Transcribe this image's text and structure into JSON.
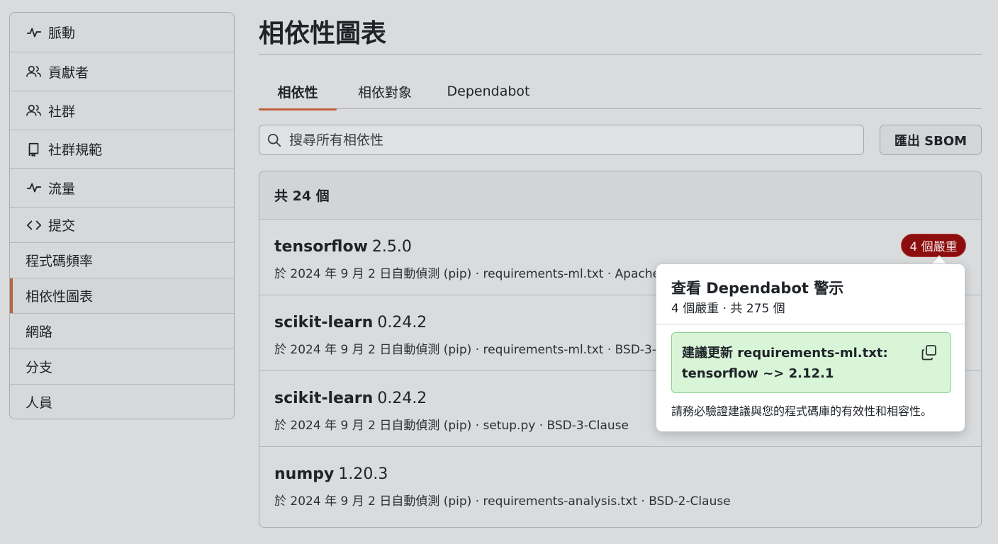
{
  "sidebar": {
    "items": [
      {
        "label": "脈動",
        "icon": "pulse-icon"
      },
      {
        "label": "貢獻者",
        "icon": "people-icon"
      },
      {
        "label": "社群",
        "icon": "people-icon"
      },
      {
        "label": "社群規範",
        "icon": "book-icon"
      },
      {
        "label": "流量",
        "icon": "pulse-icon"
      },
      {
        "label": "提交",
        "icon": "code-icon"
      },
      {
        "label": "程式碼頻率",
        "icon": ""
      },
      {
        "label": "相依性圖表",
        "icon": ""
      },
      {
        "label": "網路",
        "icon": ""
      },
      {
        "label": "分支",
        "icon": ""
      },
      {
        "label": "人員",
        "icon": ""
      }
    ],
    "active_index": 7
  },
  "page": {
    "title": "相依性圖表"
  },
  "tabs": [
    {
      "label": "相依性"
    },
    {
      "label": "相依對象"
    },
    {
      "label": "Dependabot"
    }
  ],
  "search": {
    "placeholder": "搜尋所有相依性"
  },
  "export_label": "匯出 SBOM",
  "dependencies": {
    "count_label": "共 24 個",
    "rows": [
      {
        "name": "tensorflow",
        "version": "2.5.0",
        "meta": "於 2024 年 9 月 2 日自動偵測 (pip) · requirements-ml.txt · Apache-2.0"
      },
      {
        "name": "scikit-learn",
        "version": "0.24.2",
        "meta": "於 2024 年 9 月 2 日自動偵測 (pip) · requirements-ml.txt · BSD-3-Clause"
      },
      {
        "name": "scikit-learn",
        "version": "0.24.2",
        "meta": "於 2024 年 9 月 2 日自動偵測 (pip) · setup.py · BSD-3-Clause"
      },
      {
        "name": "numpy",
        "version": "1.20.3",
        "meta": "於 2024 年 9 月 2 日自動偵測 (pip) · requirements-analysis.txt · BSD-2-Clause"
      }
    ]
  },
  "severity_badge": "4 個嚴重",
  "popover": {
    "title": "查看 Dependabot 警示",
    "subtitle": "4 個嚴重 · 共 275 個",
    "suggestion_line1": "建議更新 requirements-ml.txt:",
    "suggestion_line2": "tensorflow ~> 2.12.1",
    "note": "請務必驗證建議與您的程式碼庫的有效性和相容性。"
  },
  "colors": {
    "accent": "#c0623e",
    "critical": "#8b0d0d",
    "suggestion_bg": "#d8f5d8"
  }
}
